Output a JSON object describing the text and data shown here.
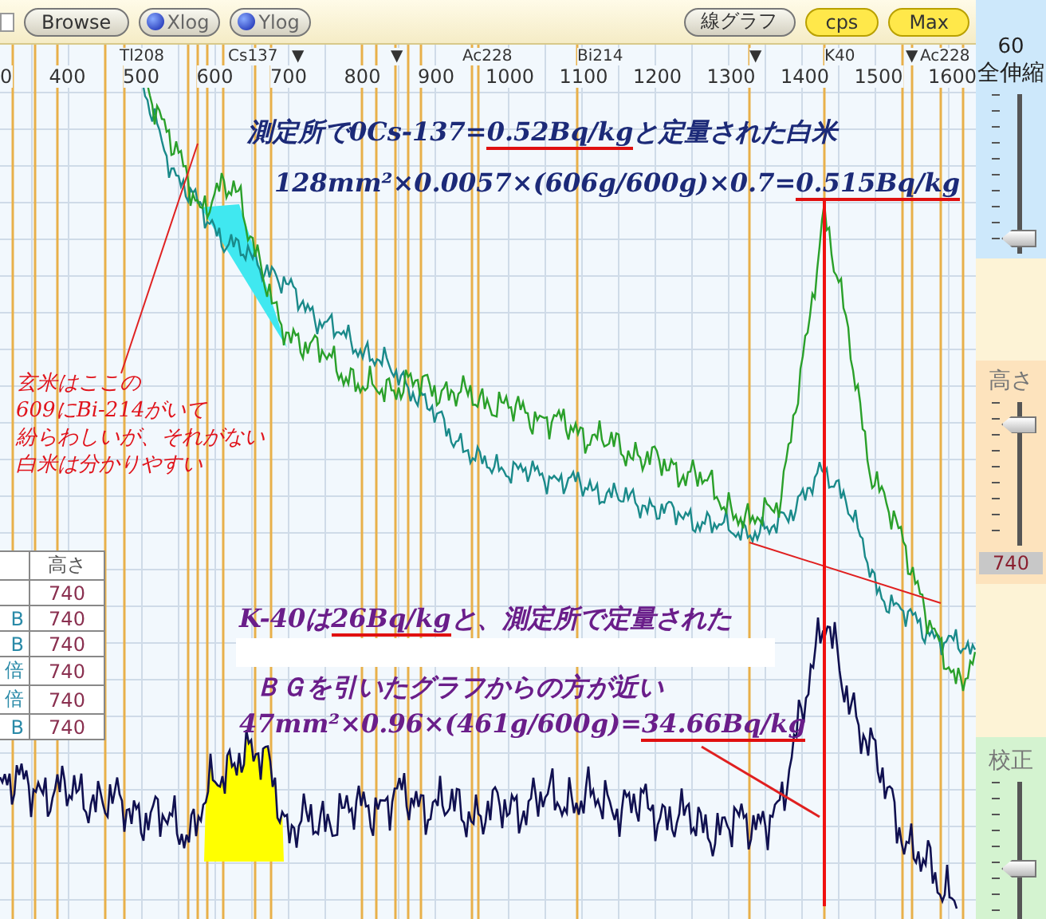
{
  "toolbar": {
    "checkbox": {
      "checked": false
    },
    "buttons": [
      {
        "kind": "push",
        "label": "Browse"
      },
      {
        "kind": "radio",
        "label": "Xlog"
      },
      {
        "kind": "radio",
        "label": "Ylog"
      },
      {
        "kind": "push",
        "label": "線グラフ"
      },
      {
        "kind": "toggle",
        "label": "cps",
        "on": true
      },
      {
        "kind": "toggle",
        "label": "Max",
        "on": true
      }
    ]
  },
  "chart": {
    "peak_labels": [
      "Tl208",
      "Cs137",
      "Ac228",
      "Bi214",
      "K40",
      "Ac228"
    ],
    "markers": [
      "▼",
      "▼",
      "▼",
      "▼"
    ],
    "x_ticks": [
      "0",
      "400",
      "500",
      "600",
      "700",
      "800",
      "900",
      "1000",
      "1100",
      "1200",
      "1300",
      "1400",
      "1500",
      "1600"
    ],
    "notes": [
      {
        "kind": "navy",
        "segments": [
          {
            "text": "測定所で0Cs-137=",
            "underline": false
          },
          {
            "text": "0.52Bq/kg",
            "underline": true
          },
          {
            "text": "と定量された白米",
            "underline": false
          }
        ]
      },
      {
        "kind": "navy",
        "segments": [
          {
            "text": "128mm²×0.0057×(606g/600g)×0.7=",
            "underline": false
          },
          {
            "text": "0.515Bq/kg",
            "underline": true
          }
        ]
      },
      {
        "kind": "red",
        "segments": [
          {
            "text": "玄米はここの",
            "underline": false
          }
        ]
      },
      {
        "kind": "red",
        "segments": [
          {
            "text": "609にBi-214がいて",
            "underline": false
          }
        ]
      },
      {
        "kind": "red",
        "segments": [
          {
            "text": "紛らわしいが、それがない",
            "underline": false
          }
        ]
      },
      {
        "kind": "red",
        "segments": [
          {
            "text": "白米は分かりやすい",
            "underline": false
          }
        ]
      },
      {
        "kind": "purple",
        "segments": [
          {
            "text": "K-40は",
            "underline": false
          },
          {
            "text": "26Bq/kg",
            "underline": true
          },
          {
            "text": "と、測定所で定量された",
            "underline": false
          }
        ]
      },
      {
        "kind": "purple",
        "segments": [
          {
            "text": "ＢＧを引いたグラフからの方が近い",
            "underline": false
          }
        ]
      },
      {
        "kind": "purple",
        "segments": [
          {
            "text": "47mm²×0.96×(461g/600g)=",
            "underline": false
          },
          {
            "text": "34.66Bq/kg",
            "underline": true
          }
        ]
      }
    ],
    "table": {
      "header": "高さ",
      "rows": [
        {
          "value": "740"
        },
        {
          "label": "B",
          "value": "740"
        },
        {
          "label": "B",
          "value": "740"
        },
        {
          "label": "倍",
          "value": "740"
        },
        {
          "label": "倍",
          "value": "740"
        },
        {
          "label": "B",
          "value": "740"
        }
      ]
    }
  },
  "side_panel": {
    "zoom": {
      "value": "60",
      "label": "全伸縮",
      "level": 0.1
    },
    "height": {
      "label": "高さ",
      "level": 0.85,
      "reading": "740"
    },
    "calibration": {
      "label": "校正",
      "level": 0.4
    }
  }
}
